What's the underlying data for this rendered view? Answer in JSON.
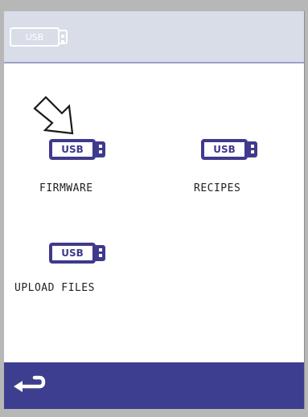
{
  "header": {
    "usb_label": "USB"
  },
  "items": [
    {
      "usb_label": "USB",
      "label": "FIRMWARE"
    },
    {
      "usb_label": "USB",
      "label": "RECIPES"
    },
    {
      "usb_label": "USB",
      "label": "UPLOAD FILES"
    }
  ],
  "icons": {
    "header": "usb-drive-icon",
    "pointer": "pointer-arrow-icon",
    "back": "back-arrow-icon"
  },
  "colors": {
    "accent": "#3f3a8d",
    "footer": "#3d3e8f",
    "header": "#d9dde8"
  }
}
